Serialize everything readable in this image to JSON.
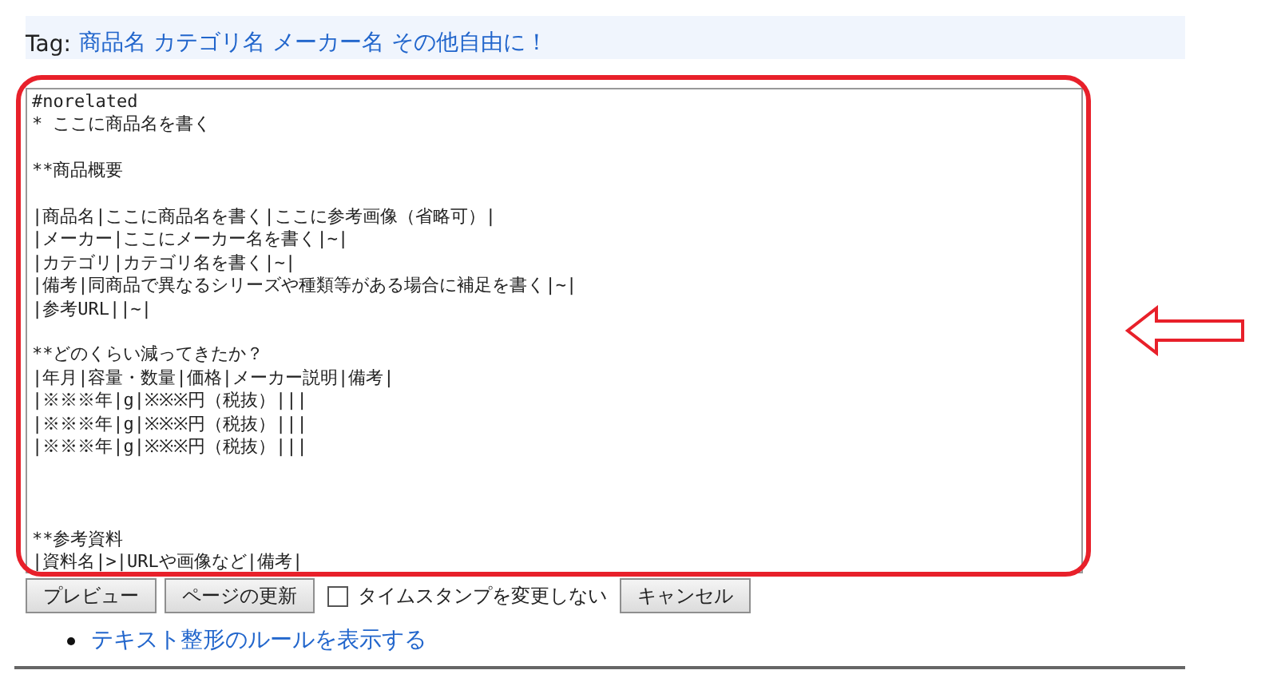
{
  "tag_bar": {
    "label": "Tag:",
    "value": "商品名 カテゴリ名 メーカー名 その他自由に！"
  },
  "editor": {
    "value": "#norelated\n* ここに商品名を書く\n\n**商品概要\n\n|商品名|ここに商品名を書く|ここに参考画像（省略可）|\n|メーカー|ここにメーカー名を書く|~|\n|カテゴリ|カテゴリ名を書く|~|\n|備考|同商品で異なるシリーズや種類等がある場合に補足を書く|~|\n|参考URL||~|\n\n**どのくらい減ってきたか？\n|年月|容量・数量|価格|メーカー説明|備考|\n|※※※年|g|※※※円（税抜）|||\n|※※※年|g|※※※円（税抜）|||\n|※※※年|g|※※※円（税抜）|||\n\n\n\n**参考資料\n|資料名|>|URLや画像など|備考|"
  },
  "buttons": [
    {
      "kind": "button",
      "label": "プレビュー"
    },
    {
      "kind": "button",
      "label": "ページの更新"
    },
    {
      "kind": "checkbox",
      "label": "タイムスタンプを変更しない",
      "checked": false
    },
    {
      "kind": "button",
      "label": "キャンセル"
    }
  ],
  "links": [
    "テキスト整形のルールを表示する"
  ]
}
